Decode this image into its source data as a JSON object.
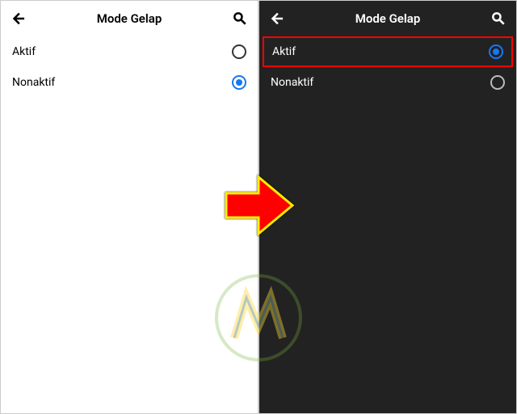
{
  "left": {
    "title": "Mode Gelap",
    "options": [
      {
        "label": "Aktif",
        "selected": false
      },
      {
        "label": "Nonaktif",
        "selected": true
      }
    ]
  },
  "right": {
    "title": "Mode Gelap",
    "options": [
      {
        "label": "Aktif",
        "selected": true
      },
      {
        "label": "Nonaktif",
        "selected": false
      }
    ]
  },
  "colors": {
    "accent": "#1877f2",
    "arrow_fill": "#ff0000",
    "arrow_stroke": "#ffed00",
    "highlight": "#ff0000"
  }
}
